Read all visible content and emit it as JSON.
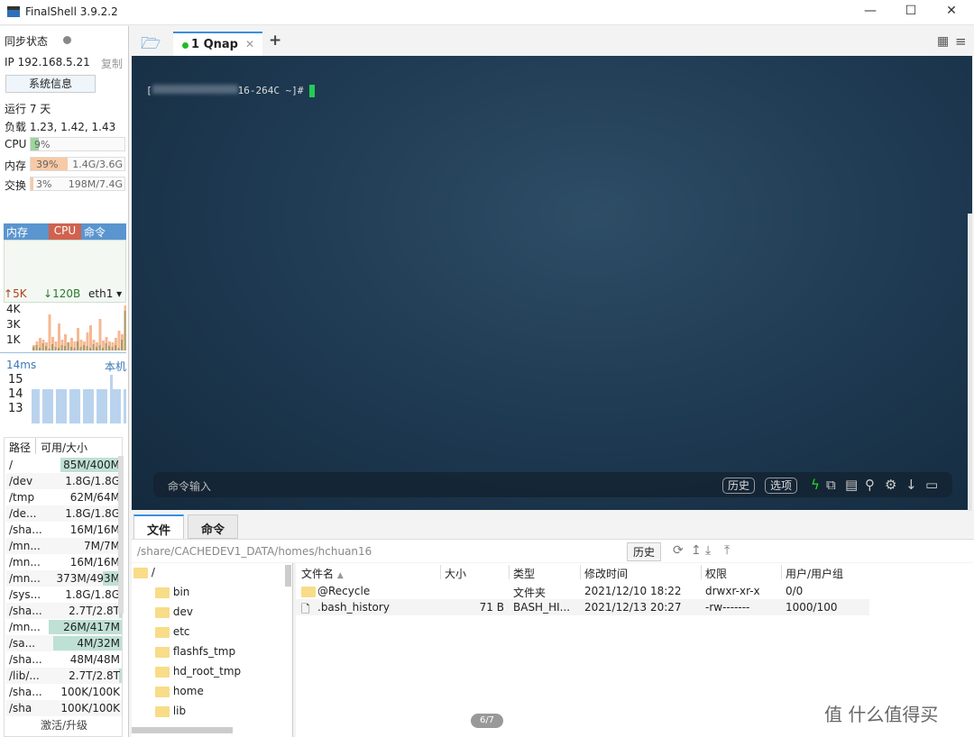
{
  "window": {
    "title": "FinalShell 3.9.2.2"
  },
  "sidebar": {
    "sync_label": "同步状态",
    "ip": "IP 192.168.5.21",
    "copy": "复制",
    "sysinfo_button": "系统信息",
    "uptime": "运行 7 天",
    "load": "负载 1.23, 1.42, 1.43",
    "cpu": {
      "label": "CPU",
      "percent": "9%",
      "fraction": 0.09
    },
    "mem": {
      "label": "内存",
      "percent": "39%",
      "detail": "1.4G/3.6G",
      "fraction": 0.39
    },
    "swap": {
      "label": "交换",
      "percent": "3%",
      "detail": "198M/7.4G",
      "fraction": 0.03
    },
    "proc_tabs": [
      "内存",
      "CPU",
      "命令"
    ],
    "net": {
      "up": "5K",
      "down": "120B",
      "iface": "eth1",
      "ticks": [
        "4K",
        "3K",
        "1K"
      ]
    },
    "ping": {
      "value": "14ms",
      "target": "本机",
      "ticks": [
        "15",
        "14",
        "13"
      ]
    },
    "disk_headers": [
      "路径",
      "可用/大小"
    ],
    "disks": [
      {
        "path": "/",
        "size": "85M/400M",
        "used": 0.79
      },
      {
        "path": "/dev",
        "size": "1.8G/1.8G",
        "used": 0.0
      },
      {
        "path": "/tmp",
        "size": "62M/64M",
        "used": 0.03
      },
      {
        "path": "/de...",
        "size": "1.8G/1.8G",
        "used": 0.0
      },
      {
        "path": "/sha...",
        "size": "16M/16M",
        "used": 0.0
      },
      {
        "path": "/mn...",
        "size": "7M/7M",
        "used": 0.0
      },
      {
        "path": "/mn...",
        "size": "16M/16M",
        "used": 0.0
      },
      {
        "path": "/mn...",
        "size": "373M/493M",
        "used": 0.24
      },
      {
        "path": "/sys...",
        "size": "1.8G/1.8G",
        "used": 0.0
      },
      {
        "path": "/sha...",
        "size": "2.7T/2.8T",
        "used": 0.03
      },
      {
        "path": "/mn...",
        "size": "26M/417M",
        "used": 0.94
      },
      {
        "path": "/sa...",
        "size": "4M/32M",
        "used": 0.88
      },
      {
        "path": "/sha...",
        "size": "48M/48M",
        "used": 0.0
      },
      {
        "path": "/lib/...",
        "size": "2.7T/2.8T",
        "used": 0.03
      },
      {
        "path": "/sha...",
        "size": "100K/100K",
        "used": 0.0
      },
      {
        "path": "/sha",
        "size": "100K/100K",
        "used": 0.0
      }
    ],
    "activate": "激活/升级"
  },
  "session_tab": {
    "label": "1 Qnap",
    "status_color": "#22bb22"
  },
  "terminal": {
    "prompt_visible": "16-264C ~]#",
    "cursor_color": "#22cc55"
  },
  "cmdbar": {
    "placeholder": "命令输入",
    "history": "历史",
    "options": "选项"
  },
  "bottom_tabs": [
    "文件",
    "命令"
  ],
  "files": {
    "path": "/share/CACHEDEV1_DATA/homes/hchuan16",
    "history": "历史",
    "tree": [
      "/",
      "bin",
      "dev",
      "etc",
      "flashfs_tmp",
      "hd_root_tmp",
      "home",
      "lib"
    ],
    "columns": [
      "文件名",
      "大小",
      "类型",
      "修改时间",
      "权限",
      "用户/用户组"
    ],
    "rows": [
      {
        "name": "@Recycle",
        "size": "",
        "type": "文件夹",
        "mtime": "2021/12/10 18:22",
        "perm": "drwxr-xr-x",
        "owner": "0/0"
      },
      {
        "name": ".bash_history",
        "size": "71 B",
        "type": "BASH_HI...",
        "mtime": "2021/12/13 20:27",
        "perm": "-rw-------",
        "owner": "1000/100"
      }
    ],
    "page": "6/7"
  },
  "watermark": "值 什么值得买"
}
